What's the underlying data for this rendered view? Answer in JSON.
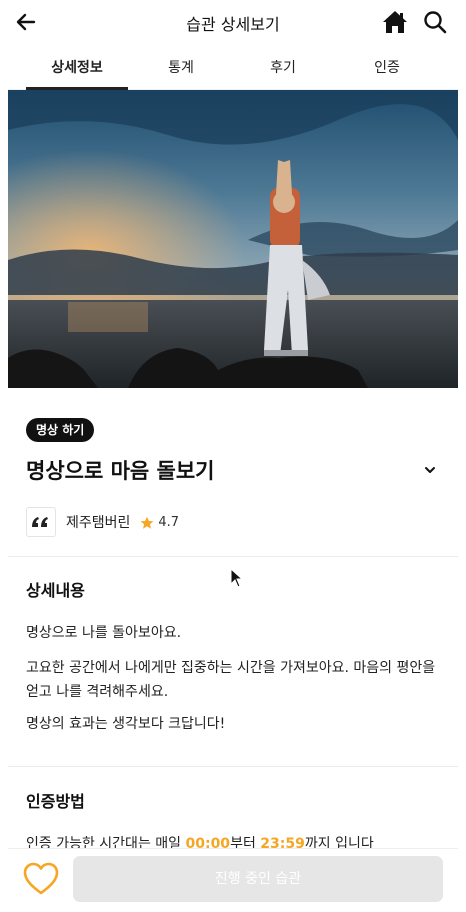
{
  "header": {
    "title": "습관 상세보기",
    "back_icon": "arrow-left-icon",
    "home_icon": "home-icon",
    "search_icon": "search-icon"
  },
  "tabs": [
    {
      "label": "상세정보",
      "active": true
    },
    {
      "label": "통계",
      "active": false
    },
    {
      "label": "후기",
      "active": false
    },
    {
      "label": "인증",
      "active": false
    }
  ],
  "hero": {
    "icon": "meditation-photo"
  },
  "habit": {
    "category": "명상 하기",
    "title": "명상으로 마음 돌보기",
    "creator": "제주탬버린",
    "rating": "4.7"
  },
  "details": {
    "title": "상세내용",
    "paragraphs": [
      "명상으로 나를 돌아보아요.",
      "고요한 공간에서 나에게만 집중하는 시간을 가져보아요. 마음의 평안을 얻고 나를 격려해주세요.",
      "명상의 효과는 생각보다 크답니다!"
    ]
  },
  "certification": {
    "title": "인증방법",
    "text_before": "인증 가능한 시간대는 매일 ",
    "start_time": "00:00",
    "text_middle": "부터 ",
    "end_time": "23:59",
    "text_after": "까지 입니다"
  },
  "bottom": {
    "heart_icon": "heart-outline-icon",
    "status_label": "진행 중인 습관"
  },
  "colors": {
    "accent": "#f5a623",
    "badge_bg": "#111111",
    "disabled_button": "#e6e6e6"
  }
}
